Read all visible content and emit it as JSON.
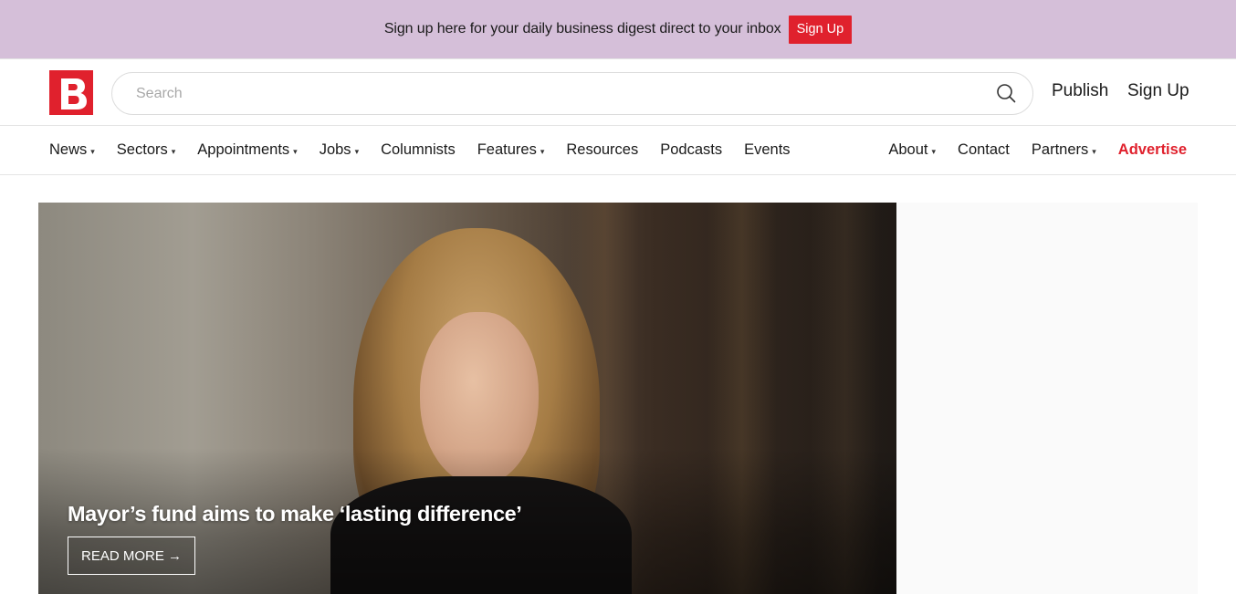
{
  "promo": {
    "text": "Sign up here for your daily business digest direct to your inbox",
    "button_label": "Sign Up"
  },
  "header": {
    "logo_letter": "B",
    "search_placeholder": "Search",
    "publish_label": "Publish",
    "signup_label": "Sign Up"
  },
  "nav": {
    "left": [
      {
        "label": "News",
        "dropdown": true
      },
      {
        "label": "Sectors",
        "dropdown": true
      },
      {
        "label": "Appointments",
        "dropdown": true
      },
      {
        "label": "Jobs",
        "dropdown": true
      },
      {
        "label": "Columnists",
        "dropdown": false
      },
      {
        "label": "Features",
        "dropdown": true
      },
      {
        "label": "Resources",
        "dropdown": false
      },
      {
        "label": "Podcasts",
        "dropdown": false
      },
      {
        "label": "Events",
        "dropdown": false
      }
    ],
    "right": [
      {
        "label": "About",
        "dropdown": true
      },
      {
        "label": "Contact",
        "dropdown": false
      },
      {
        "label": "Partners",
        "dropdown": true
      },
      {
        "label": "Advertise",
        "dropdown": false
      }
    ],
    "caret": "▾"
  },
  "hero": {
    "title": "Mayor’s fund aims to make ‘lasting difference’",
    "read_more": "READ MORE →"
  },
  "colors": {
    "brand": "#e0212d",
    "promo_bg": "#d5bfd9"
  }
}
